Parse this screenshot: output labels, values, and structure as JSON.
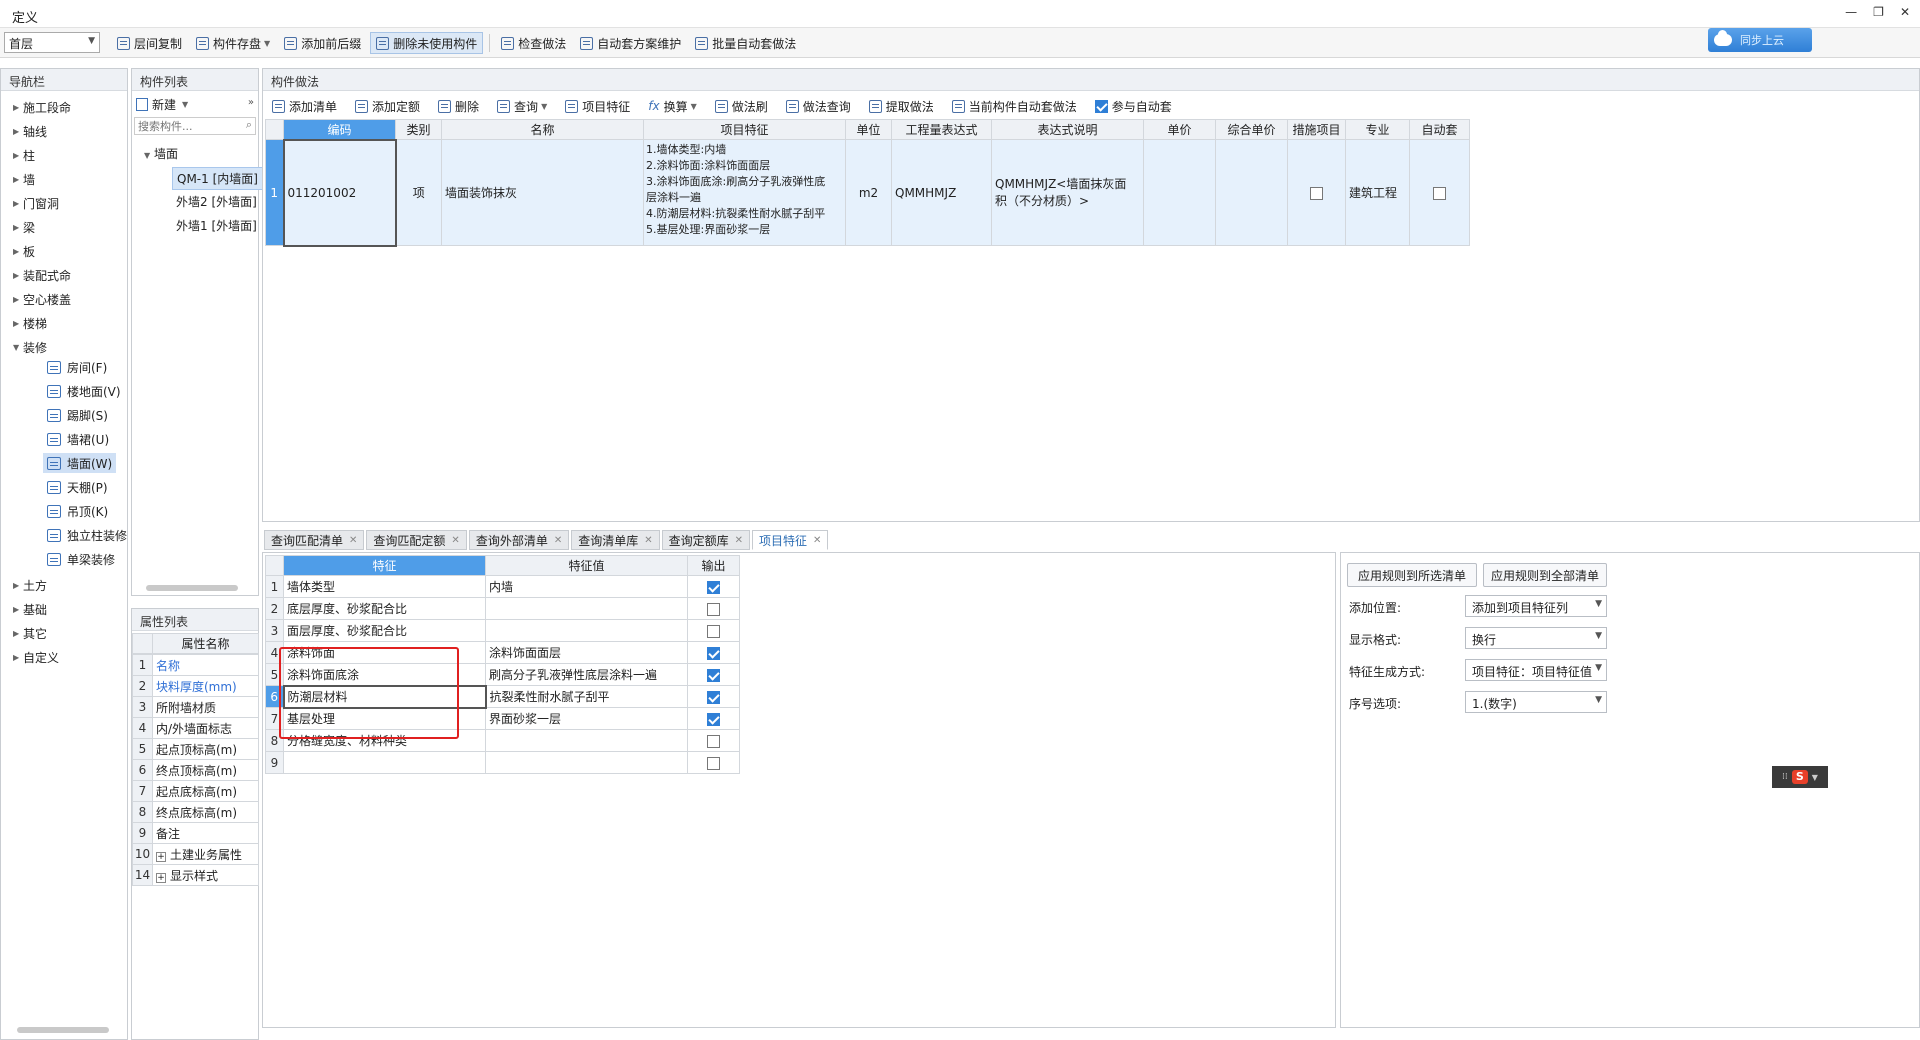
{
  "window": {
    "title": "定义",
    "minimize": "—",
    "restore": "❐",
    "close": "✕"
  },
  "toolbar": {
    "floor": "首层",
    "items": [
      "层间复制",
      "构件存盘",
      "添加前后缀",
      "删除未使用构件",
      "检查做法",
      "自动套方案维护",
      "批量自动套做法"
    ],
    "cloud_label": "同步上云"
  },
  "nav": {
    "header": "导航栏",
    "items": [
      "施工段命",
      "轴线",
      "柱",
      "墙",
      "门窗洞",
      "梁",
      "板",
      "装配式命",
      "空心楼盖",
      "楼梯",
      "装修"
    ],
    "sub_items": [
      "房间(F)",
      "楼地面(V)",
      "踢脚(S)",
      "墙裙(U)",
      "墙面(W)",
      "天棚(P)",
      "吊顶(K)",
      "独立柱装修",
      "单梁装修"
    ],
    "more_items": [
      "土方",
      "基础",
      "其它",
      "自定义"
    ]
  },
  "components": {
    "header": "构件列表",
    "new_label": "新建",
    "search_placeholder": "搜索构件...",
    "group": "墙面",
    "items": [
      "QM-1 [内墙面]",
      "外墙2 [外墙面]",
      "外墙1 [外墙面]"
    ]
  },
  "properties": {
    "header": "属性列表",
    "col_name": "属性名称",
    "rows": [
      {
        "n": "1",
        "name": "名称"
      },
      {
        "n": "2",
        "name": "块料厚度(mm)"
      },
      {
        "n": "3",
        "name": "所附墙材质"
      },
      {
        "n": "4",
        "name": "内/外墙面标志"
      },
      {
        "n": "5",
        "name": "起点顶标高(m)"
      },
      {
        "n": "6",
        "name": "终点顶标高(m)"
      },
      {
        "n": "7",
        "name": "起点底标高(m)"
      },
      {
        "n": "8",
        "name": "终点底标高(m)"
      },
      {
        "n": "9",
        "name": "备注"
      },
      {
        "n": "10",
        "name": "土建业务属性"
      },
      {
        "n": "14",
        "name": "显示样式"
      }
    ]
  },
  "method": {
    "header": "构件做法",
    "toolbar": [
      "添加清单",
      "添加定额",
      "删除",
      "查询",
      "项目特征",
      "换算",
      "做法刷",
      "做法查询",
      "提取做法",
      "当前构件自动套做法"
    ],
    "auto_label": "参与自动套",
    "columns": [
      "编码",
      "类别",
      "名称",
      "项目特征",
      "单位",
      "工程量表达式",
      "表达式说明",
      "单价",
      "综合单价",
      "措施项目",
      "专业",
      "自动套"
    ],
    "row": {
      "n": "1",
      "code": "011201002",
      "type": "项",
      "name": "墙面装饰抹灰",
      "features": [
        "1.墙体类型:内墙",
        "2.涂料饰面:涂料饰面面层",
        "3.涂料饰面底涂:刷高分子乳液弹性底",
        "层涂料一遍",
        "4.防潮层材料:抗裂柔性耐水腻子刮平",
        "5.基层处理:界面砂浆一层"
      ],
      "unit": "m2",
      "expr": "QMMHMJZ",
      "expr_desc": [
        "QMMHMJZ<墙面抹灰面",
        "积（不分材质）>"
      ],
      "major": "建筑工程"
    }
  },
  "bottom_tabs": [
    "查询匹配清单",
    "查询匹配定额",
    "查询外部清单",
    "查询清单库",
    "查询定额库",
    "项目特征"
  ],
  "features": {
    "columns": [
      "特征",
      "特征值",
      "输出"
    ],
    "rows": [
      {
        "n": "1",
        "feature": "墙体类型",
        "value": "内墙",
        "out": true
      },
      {
        "n": "2",
        "feature": "底层厚度、砂浆配合比",
        "value": "",
        "out": false
      },
      {
        "n": "3",
        "feature": "面层厚度、砂浆配合比",
        "value": "",
        "out": false
      },
      {
        "n": "4",
        "feature": "涂料饰面",
        "value": "涂料饰面面层",
        "out": true
      },
      {
        "n": "5",
        "feature": "涂料饰面底涂",
        "value": "刷高分子乳液弹性底层涂料一遍",
        "out": true
      },
      {
        "n": "6",
        "feature": "防潮层材料",
        "value": "抗裂柔性耐水腻子刮平",
        "out": true
      },
      {
        "n": "7",
        "feature": "基层处理",
        "value": "界面砂浆一层",
        "out": true
      },
      {
        "n": "8",
        "feature": "分格缝宽度、材料种类",
        "value": "",
        "out": false
      },
      {
        "n": "9",
        "feature": "",
        "value": "",
        "out": false
      }
    ]
  },
  "rules": {
    "btn_selected": "应用规则到所选清单",
    "btn_all": "应用规则到全部清单",
    "fields": [
      {
        "label": "添加位置:",
        "value": "添加到项目特征列"
      },
      {
        "label": "显示格式:",
        "value": "换行"
      },
      {
        "label": "特征生成方式:",
        "value": "项目特征：项目特征值"
      },
      {
        "label": "序号选项:",
        "value": "1.(数字)"
      }
    ]
  },
  "ime": {
    "label": "S"
  }
}
